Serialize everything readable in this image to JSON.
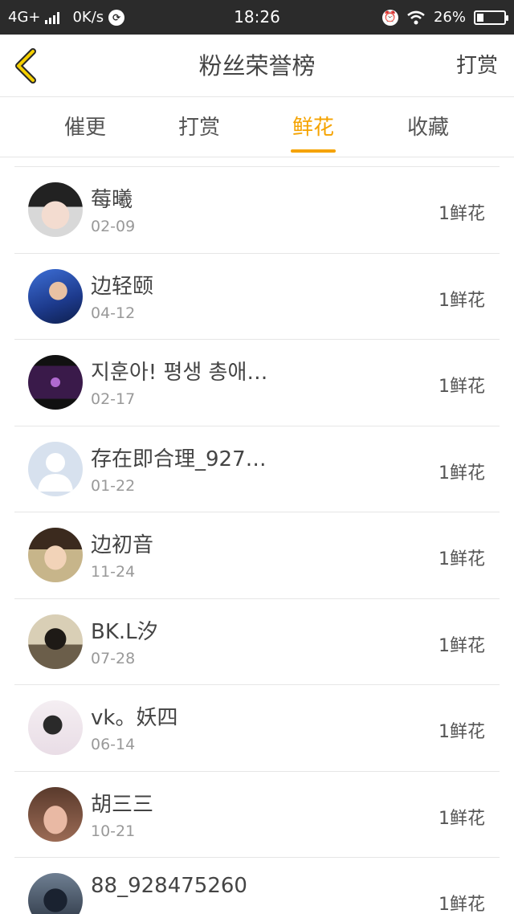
{
  "status_bar": {
    "network": "4G+",
    "speed": "0K/s",
    "time": "18:26",
    "battery": "26%",
    "battery_level": 0.26
  },
  "header": {
    "back_icon": "chevron-left-icon",
    "title": "粉丝荣誉榜",
    "action_label": "打赏"
  },
  "tabs": [
    {
      "label": "催更",
      "active": false
    },
    {
      "label": "打赏",
      "active": false
    },
    {
      "label": "鲜花",
      "active": true
    },
    {
      "label": "收藏",
      "active": false
    }
  ],
  "colors": {
    "accent": "#f5a300",
    "status_bar": "#2b2b2b",
    "divider": "#e6e6e6"
  },
  "fans": [
    {
      "name": "莓曦",
      "date": "02-09",
      "count": "1鲜花",
      "avatar": "photo-avatar"
    },
    {
      "name": "边轻颐",
      "date": "04-12",
      "count": "1鲜花",
      "avatar": "photo-avatar"
    },
    {
      "name": "지훈아! 평생 총애…",
      "date": "02-17",
      "count": "1鲜花",
      "avatar": "photo-avatar"
    },
    {
      "name": "存在即合理_927…",
      "date": "01-22",
      "count": "1鲜花",
      "avatar": "default-avatar"
    },
    {
      "name": "边初音",
      "date": "11-24",
      "count": "1鲜花",
      "avatar": "photo-avatar"
    },
    {
      "name": "BK.L汐",
      "date": "07-28",
      "count": "1鲜花",
      "avatar": "photo-avatar"
    },
    {
      "name": "vk。妖四",
      "date": "06-14",
      "count": "1鲜花",
      "avatar": "photo-avatar"
    },
    {
      "name": "胡三三",
      "date": "10-21",
      "count": "1鲜花",
      "avatar": "photo-avatar"
    },
    {
      "name": "88_928475260",
      "date": "",
      "count": "1鲜花",
      "avatar": "photo-avatar"
    }
  ]
}
